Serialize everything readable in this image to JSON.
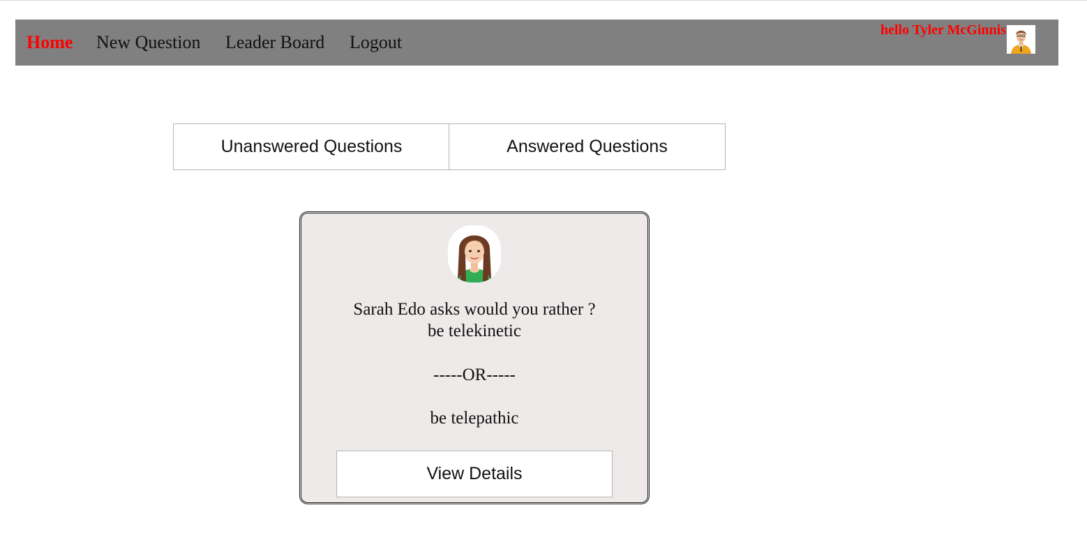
{
  "nav": {
    "home": "Home",
    "new_question": "New Question",
    "leader_board": "Leader Board",
    "logout": "Logout",
    "greeting": "hello Tyler McGinnis"
  },
  "tabs": {
    "unanswered": "Unanswered Questions",
    "answered": "Answered Questions"
  },
  "question_card": {
    "author_prompt": "Sarah Edo asks would you rather ?",
    "option_one": "be telekinetic",
    "separator": "-----OR-----",
    "option_two": "be telepathic",
    "button_label": "View Details"
  },
  "colors": {
    "navbar_bg": "#808080",
    "active_link": "#ff0000",
    "card_bg": "#eeeae9"
  }
}
